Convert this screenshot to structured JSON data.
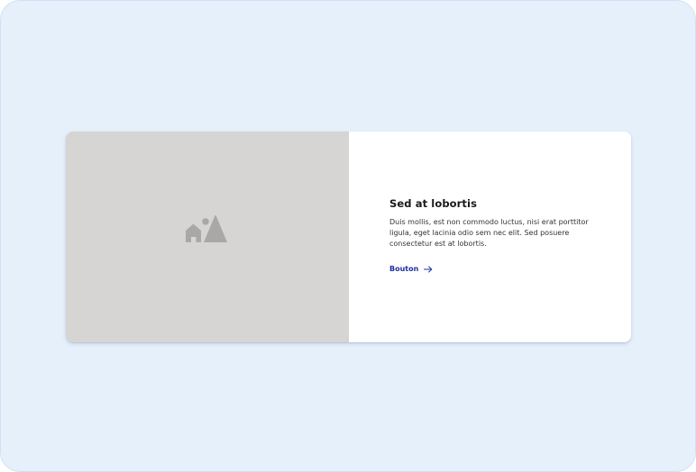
{
  "card": {
    "media": {
      "icon": "image-placeholder-icon"
    },
    "title": "Sed at lobortis",
    "description": "Duis mollis, est non commodo luctus, nisi erat porttitor ligula, eget lacinia odio sem nec elit. Sed posuere consectetur est at lobortis.",
    "button": {
      "label": "Bouton",
      "icon": "arrow-right-icon"
    }
  },
  "colors": {
    "page_background": "#e6f0fb",
    "media_background": "#d6d5d3",
    "icon_color": "#a9a8a6",
    "button_text": "#1f2f9e",
    "title_text": "#1a1a1a",
    "body_text": "#333333"
  }
}
